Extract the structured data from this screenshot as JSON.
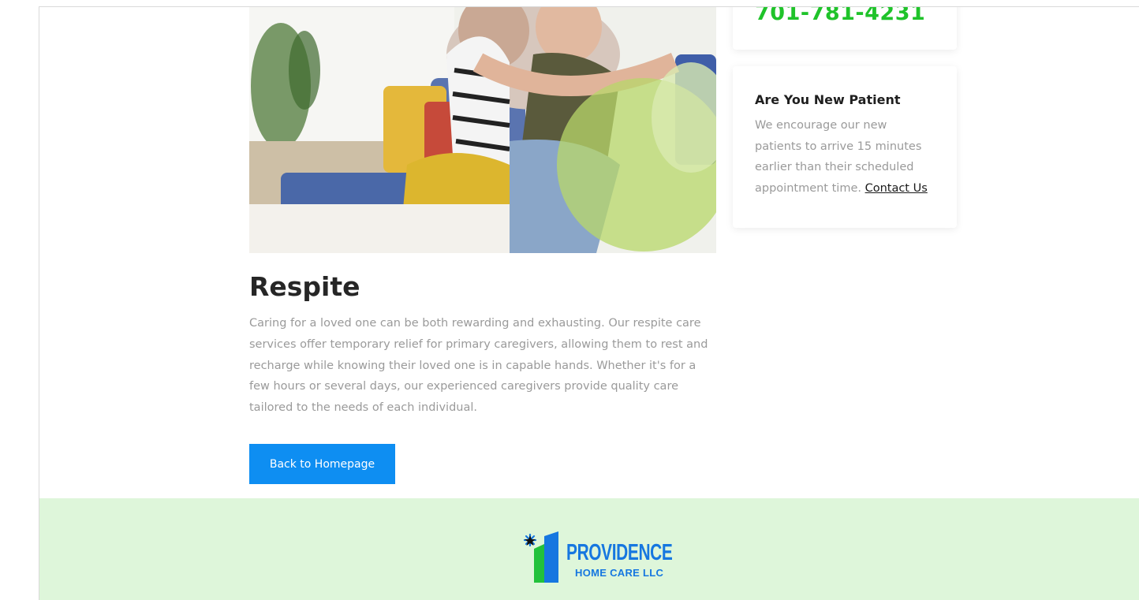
{
  "sidebar": {
    "phone": "701-781-4231",
    "new_patient": {
      "title": "Are You New Patient",
      "text": "We encourage our new patients to arrive 15 minutes earlier than their scheduled appointment time.",
      "link_label": "Contact Us"
    }
  },
  "service": {
    "image_alt": "Older woman hugging a young woman on a sofa",
    "title": "Respite",
    "description": "Caring for a loved one can be both rewarding and exhausting. Our respite care services offer temporary relief for primary caregivers, allowing them to rest and recharge while knowing their loved one is in capable hands. Whether it's for a few hours or several days, our experienced caregivers provide quality care tailored to the needs of each individual.",
    "button_label": "Back to Homepage"
  },
  "footer": {
    "logo_name": "PROVIDENCE",
    "logo_sub": "HOME CARE LLC"
  },
  "colors": {
    "accent_green": "#1fc32a",
    "button_blue": "#0e8ef2",
    "footer_bg": "#def6da",
    "logo_blue": "#1677e0"
  }
}
